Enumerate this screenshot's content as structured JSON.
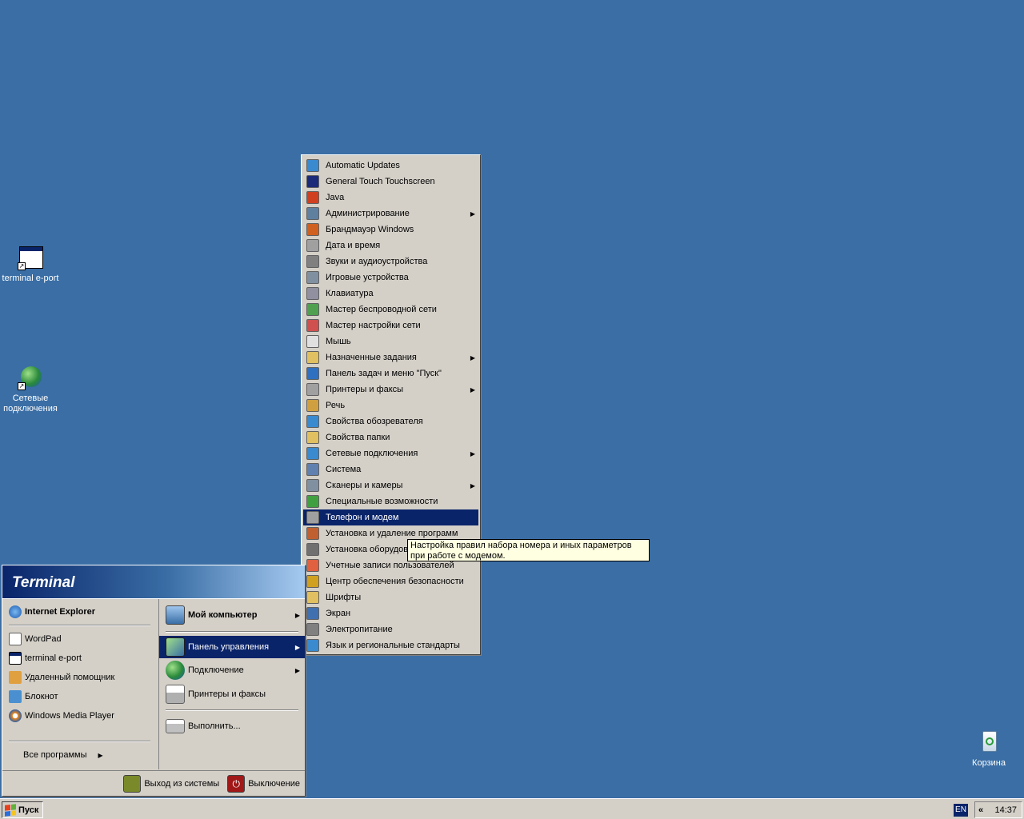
{
  "desktop": {
    "icons": [
      {
        "label": "terminal e-port",
        "icon": "window-shortcut-icon"
      },
      {
        "label": "Сетевые подключения",
        "icon": "network-connections-icon"
      },
      {
        "label": "Корзина",
        "icon": "recycle-bin-icon"
      }
    ]
  },
  "start_menu": {
    "header": "Terminal",
    "left_items": [
      {
        "label": "Internet Explorer",
        "icon": "internet-explorer-icon",
        "color": "#2a6fdb"
      },
      {
        "label": "WordPad",
        "icon": "wordpad-icon",
        "color": "#ffffff"
      },
      {
        "label": "terminal e-port",
        "icon": "window-icon",
        "color": "#ffffff"
      },
      {
        "label": "Удаленный помощник",
        "icon": "remote-assistant-icon",
        "color": "#e0a040"
      },
      {
        "label": "Блокнот",
        "icon": "notepad-icon",
        "color": "#4a90d0"
      },
      {
        "label": "Windows Media Player",
        "icon": "media-player-icon",
        "color": "#f08a1c"
      }
    ],
    "all_programs": "Все программы",
    "right_items": [
      {
        "label": "Мой компьютер",
        "icon": "my-computer-icon",
        "arrow": true
      },
      {
        "label": "Панель управления",
        "icon": "control-panel-icon",
        "arrow": true,
        "selected": true
      },
      {
        "label": "Подключение",
        "icon": "connect-icon",
        "arrow": true
      },
      {
        "label": "Принтеры и факсы",
        "icon": "printer-icon",
        "arrow": false
      }
    ],
    "run": "Выполнить...",
    "logoff": "Выход из системы",
    "shutdown": "Выключение"
  },
  "control_panel": {
    "items": [
      {
        "label": "Automatic Updates",
        "arrow": false,
        "color": "#3a8ad0"
      },
      {
        "label": "General Touch Touchscreen",
        "arrow": false,
        "color": "#1c2a7a"
      },
      {
        "label": "Java",
        "arrow": false,
        "color": "#d04020"
      },
      {
        "label": "Администрирование",
        "arrow": true,
        "color": "#6080a0"
      },
      {
        "label": "Брандмауэр Windows",
        "arrow": false,
        "color": "#d06020"
      },
      {
        "label": "Дата и время",
        "arrow": false,
        "color": "#a0a0a0"
      },
      {
        "label": "Звуки и аудиоустройства",
        "arrow": false,
        "color": "#808080"
      },
      {
        "label": "Игровые устройства",
        "arrow": false,
        "color": "#8090a0"
      },
      {
        "label": "Клавиатура",
        "arrow": false,
        "color": "#9090a0"
      },
      {
        "label": "Мастер беспроводной сети",
        "arrow": false,
        "color": "#50a050"
      },
      {
        "label": "Мастер настройки сети",
        "arrow": false,
        "color": "#d05050"
      },
      {
        "label": "Мышь",
        "arrow": false,
        "color": "#e0e0e0"
      },
      {
        "label": "Назначенные задания",
        "arrow": true,
        "color": "#e0c060"
      },
      {
        "label": "Панель задач и меню \"Пуск\"",
        "arrow": false,
        "color": "#3070c0"
      },
      {
        "label": "Принтеры и факсы",
        "arrow": true,
        "color": "#a0a0a0"
      },
      {
        "label": "Речь",
        "arrow": false,
        "color": "#d0a040"
      },
      {
        "label": "Свойства обозревателя",
        "arrow": false,
        "color": "#3a8ad0"
      },
      {
        "label": "Свойства папки",
        "arrow": false,
        "color": "#e0c060"
      },
      {
        "label": "Сетевые подключения",
        "arrow": true,
        "color": "#3a8ad0"
      },
      {
        "label": "Система",
        "arrow": false,
        "color": "#6080b0"
      },
      {
        "label": "Сканеры и камеры",
        "arrow": true,
        "color": "#8090a0"
      },
      {
        "label": "Специальные возможности",
        "arrow": false,
        "color": "#40a040"
      },
      {
        "label": "Телефон и модем",
        "arrow": false,
        "selected": true,
        "color": "#a0a0a0"
      },
      {
        "label": "Установка и удаление программ",
        "arrow": false,
        "color": "#c06030"
      },
      {
        "label": "Установка оборудования",
        "arrow": false,
        "color": "#707070"
      },
      {
        "label": "Учетные записи пользователей",
        "arrow": false,
        "color": "#e06040"
      },
      {
        "label": "Центр обеспечения безопасности",
        "arrow": false,
        "color": "#d0a020"
      },
      {
        "label": "Шрифты",
        "arrow": false,
        "color": "#e0c060"
      },
      {
        "label": "Экран",
        "arrow": false,
        "color": "#4070b0"
      },
      {
        "label": "Электропитание",
        "arrow": false,
        "color": "#808080"
      },
      {
        "label": "Язык и региональные стандарты",
        "arrow": false,
        "color": "#3a8ad0"
      }
    ]
  },
  "tooltip": {
    "text": "Настройка правил набора номера и иных параметров при работе с модемом."
  },
  "taskbar": {
    "start_label": "Пуск",
    "language": "EN",
    "collapse": "«",
    "clock": "14:37"
  }
}
